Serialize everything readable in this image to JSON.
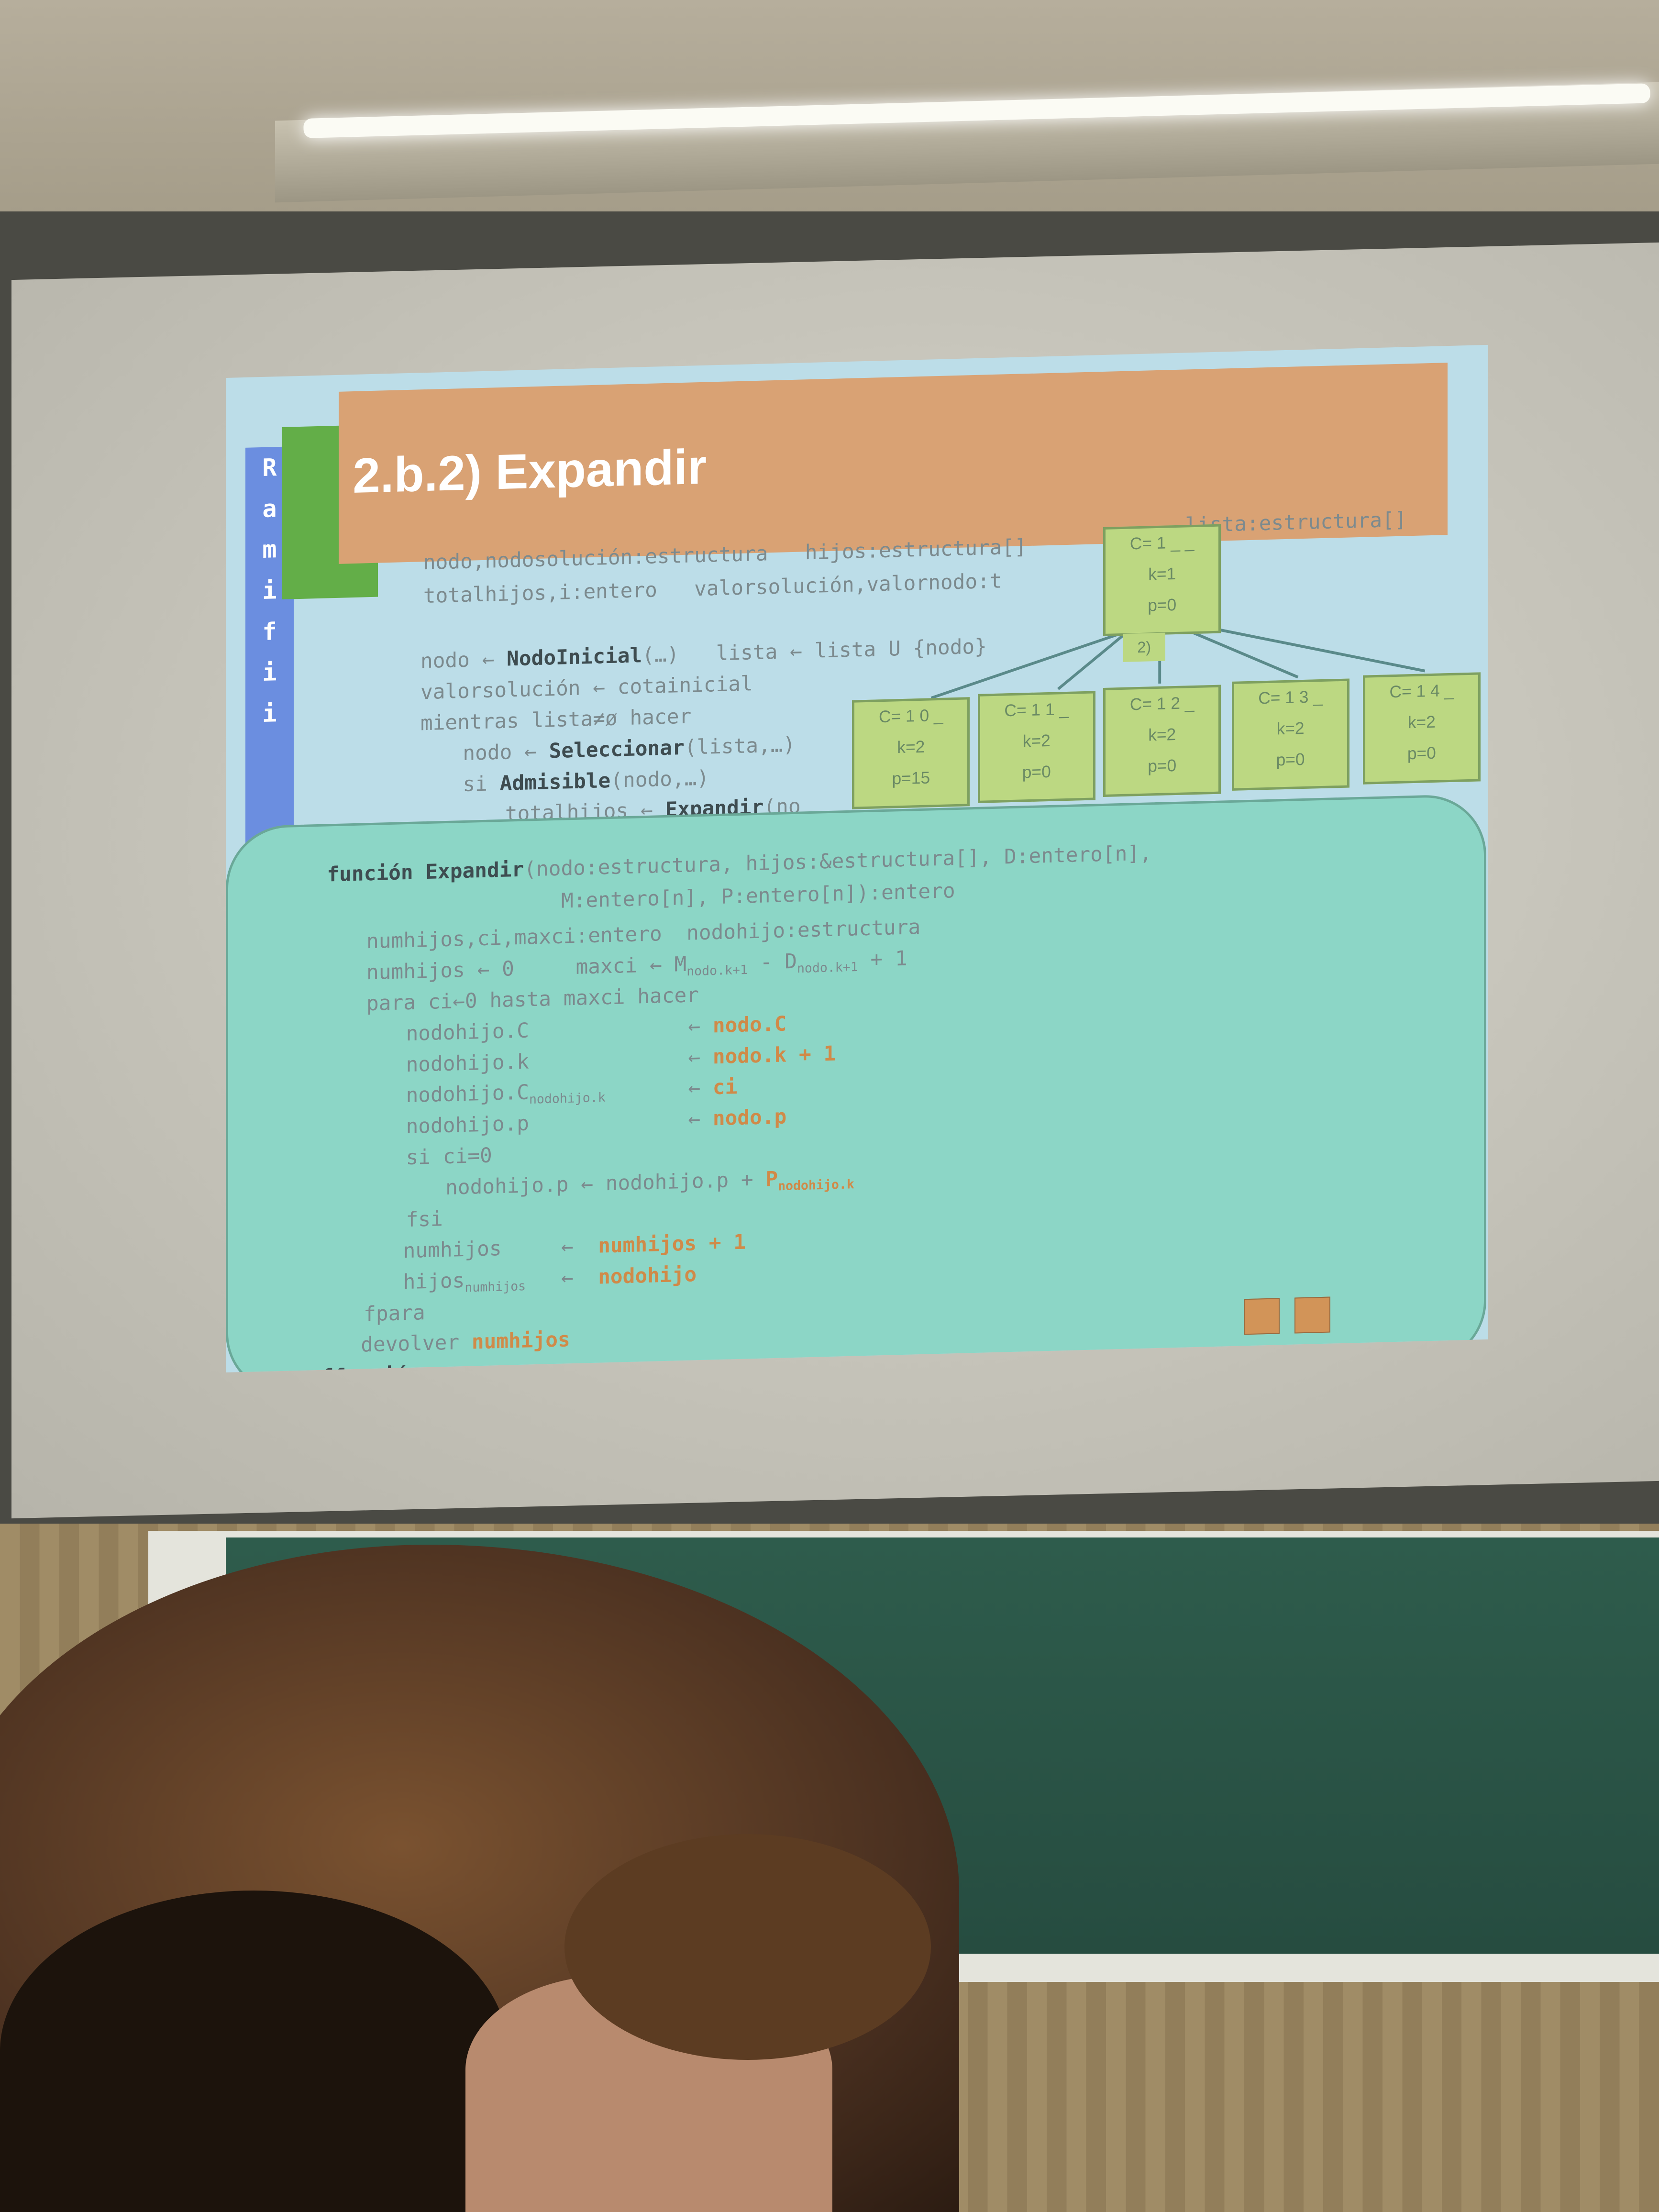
{
  "slide": {
    "title": "2.b.2) Expandir",
    "sidebar_letters": [
      "R",
      "a",
      "m",
      "i",
      "f",
      "i",
      "i"
    ],
    "outer_code": {
      "line1a": "nodo,nodosolución:estructura",
      "line1b": "hijos:estructura[]",
      "line1c": "lista:estructura[]",
      "line2a": "totalhijos,i:entero",
      "line2b": "valorsolución,valornodo:t",
      "line3a": "nodo ← ",
      "line3b": "NodoInicial",
      "line3c": "(…)   lista ← lista U {nodo}",
      "line4": "valorsolución ← cotainicial",
      "line5": "mientras lista≠ø hacer",
      "line6a": "nodo ← ",
      "line6b": "Seleccionar",
      "line6c": "(lista,…)",
      "line7a": "si ",
      "line7b": "Admisible",
      "line7c": "(nodo,…)",
      "line8a": "totalhijos ← ",
      "line8b": "Expandir",
      "line8c": "(no"
    },
    "tree": {
      "root": {
        "c": "C= 1 _ _",
        "k": "k=1",
        "p": "p=0"
      },
      "step_label": "2)",
      "children": [
        {
          "c": "C= 1 0 _",
          "k": "k=2",
          "p": "p=15"
        },
        {
          "c": "C= 1 1 _",
          "k": "k=2",
          "p": "p=0"
        },
        {
          "c": "C= 1 2 _",
          "k": "k=2",
          "p": "p=0"
        },
        {
          "c": "C= 1 3 _",
          "k": "k=2",
          "p": "p=0"
        },
        {
          "c": "C= 1 4 _",
          "k": "k=2",
          "p": "p=0"
        }
      ]
    },
    "expandir_code": {
      "sig1a": "función Expandir",
      "sig1b": "(nodo:estructura, hijos:&estructura[], D:entero[n],",
      "sig2": "M:entero[n], P:entero[n]):entero",
      "decl": "numhijos,ci,maxci:entero  nodohijo:estructura",
      "init": "numhijos ← 0     maxci ← M",
      "init_sub1": "nodo.k+1",
      "init_mid": " - D",
      "init_sub2": "nodo.k+1",
      "init_end": " + 1",
      "para": "para ci←0 hasta maxci hacer",
      "a1l": "nodohijo.C",
      "a1r": "nodo.C",
      "a2l": "nodohijo.k",
      "a2r": "nodo.k + 1",
      "a3l": "nodohijo.C",
      "a3sub": "nodohijo.k",
      "a3r": "ci",
      "a4l": "nodohijo.p",
      "a4r": "nodo.p",
      "arrow": "←",
      "si": "si ci=0",
      "upd": "nodohijo.p ← nodohijo.p + ",
      "upd_r": "P",
      "upd_sub": "nodohijo.k",
      "fsi": "fsi",
      "n1l": "numhijos",
      "n1r": "numhijos + 1",
      "n2l": "hijos",
      "n2sub": "numhijos",
      "n2r": "nodohijo",
      "fpara": "fpara",
      "dev": "devolver ",
      "dev_r": "numhijos",
      "end": "ffunción"
    },
    "colors": {
      "title_bar": "#d9a274",
      "slide_bg": "#bcdde8",
      "callout": "#8cd6c6",
      "node": "#bcd882",
      "highlight": "#d08a48",
      "sidebar": "#6b8ee0"
    }
  }
}
